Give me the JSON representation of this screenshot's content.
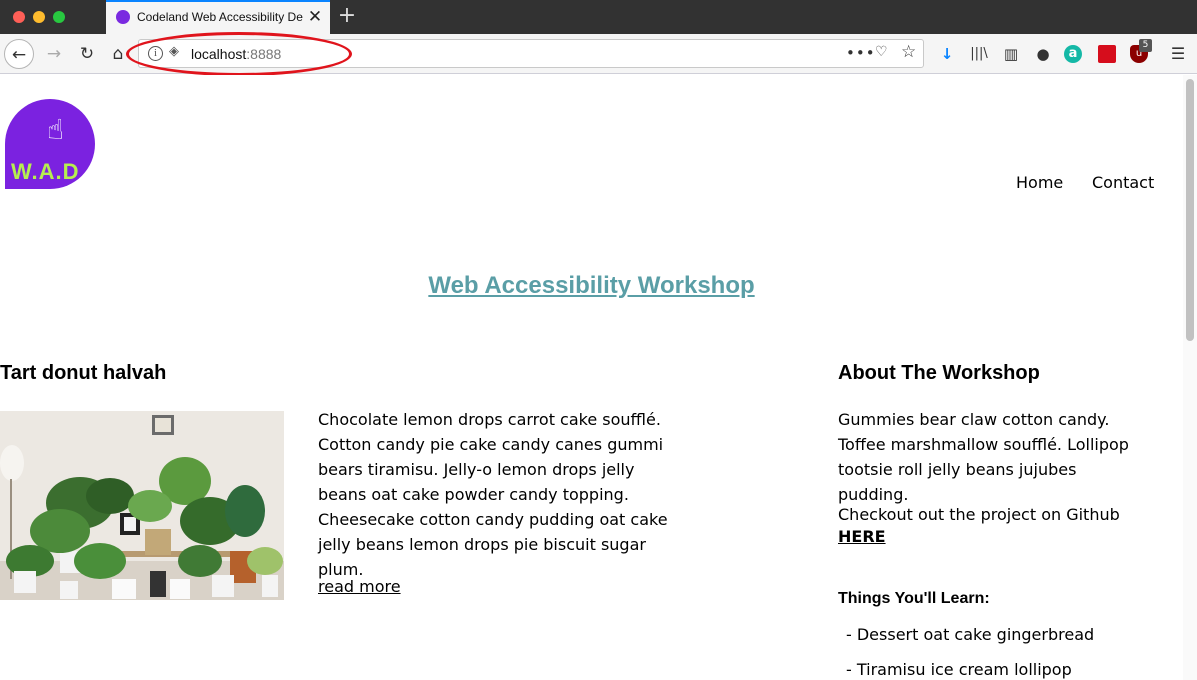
{
  "browser": {
    "tab_title": "Codeland Web Accessibility De",
    "url_host": "localhost",
    "url_port": ":8888",
    "extension_badge": "5",
    "icons": [
      "back-icon",
      "forward-icon",
      "reload-icon",
      "home-icon",
      "info-icon",
      "page-actions-icon",
      "pocket-icon",
      "bookmark-star-icon",
      "download-icon",
      "library-icon",
      "sidebar-icon",
      "account-icon",
      "menu-icon"
    ]
  },
  "page": {
    "logo_text": "W.A.D",
    "nav": {
      "home": "Home",
      "contact": "Contact"
    },
    "title": "Web Accessibility Workshop",
    "article": {
      "title": "Tart donut halvah",
      "text": "Chocolate lemon drops carrot cake soufflé. Cotton candy pie cake candy canes gummi bears tiramisu. Jelly-o lemon drops jelly beans oat cake powder candy topping. Cheesecake cotton candy pudding oat cake jelly beans lemon drops pie biscuit sugar plum.",
      "read_more": "read more"
    },
    "about": {
      "title": "About The Workshop",
      "text": "Gummies bear claw cotton candy. Toffee marshmallow soufflé. Lollipop tootsie roll jelly beans jujubes pudding.",
      "github_text": "Checkout out the project on Github",
      "here_link": "HERE",
      "learn_title": "Things You'll Learn:",
      "learn_items": [
        "- Dessert oat cake gingerbread",
        "- Tiramisu ice cream lollipop"
      ]
    }
  },
  "colors": {
    "logo_bg": "#7b22e0",
    "logo_text": "#b6ef4f",
    "title": "#5a9ea6",
    "annotation": "#e0141c"
  }
}
